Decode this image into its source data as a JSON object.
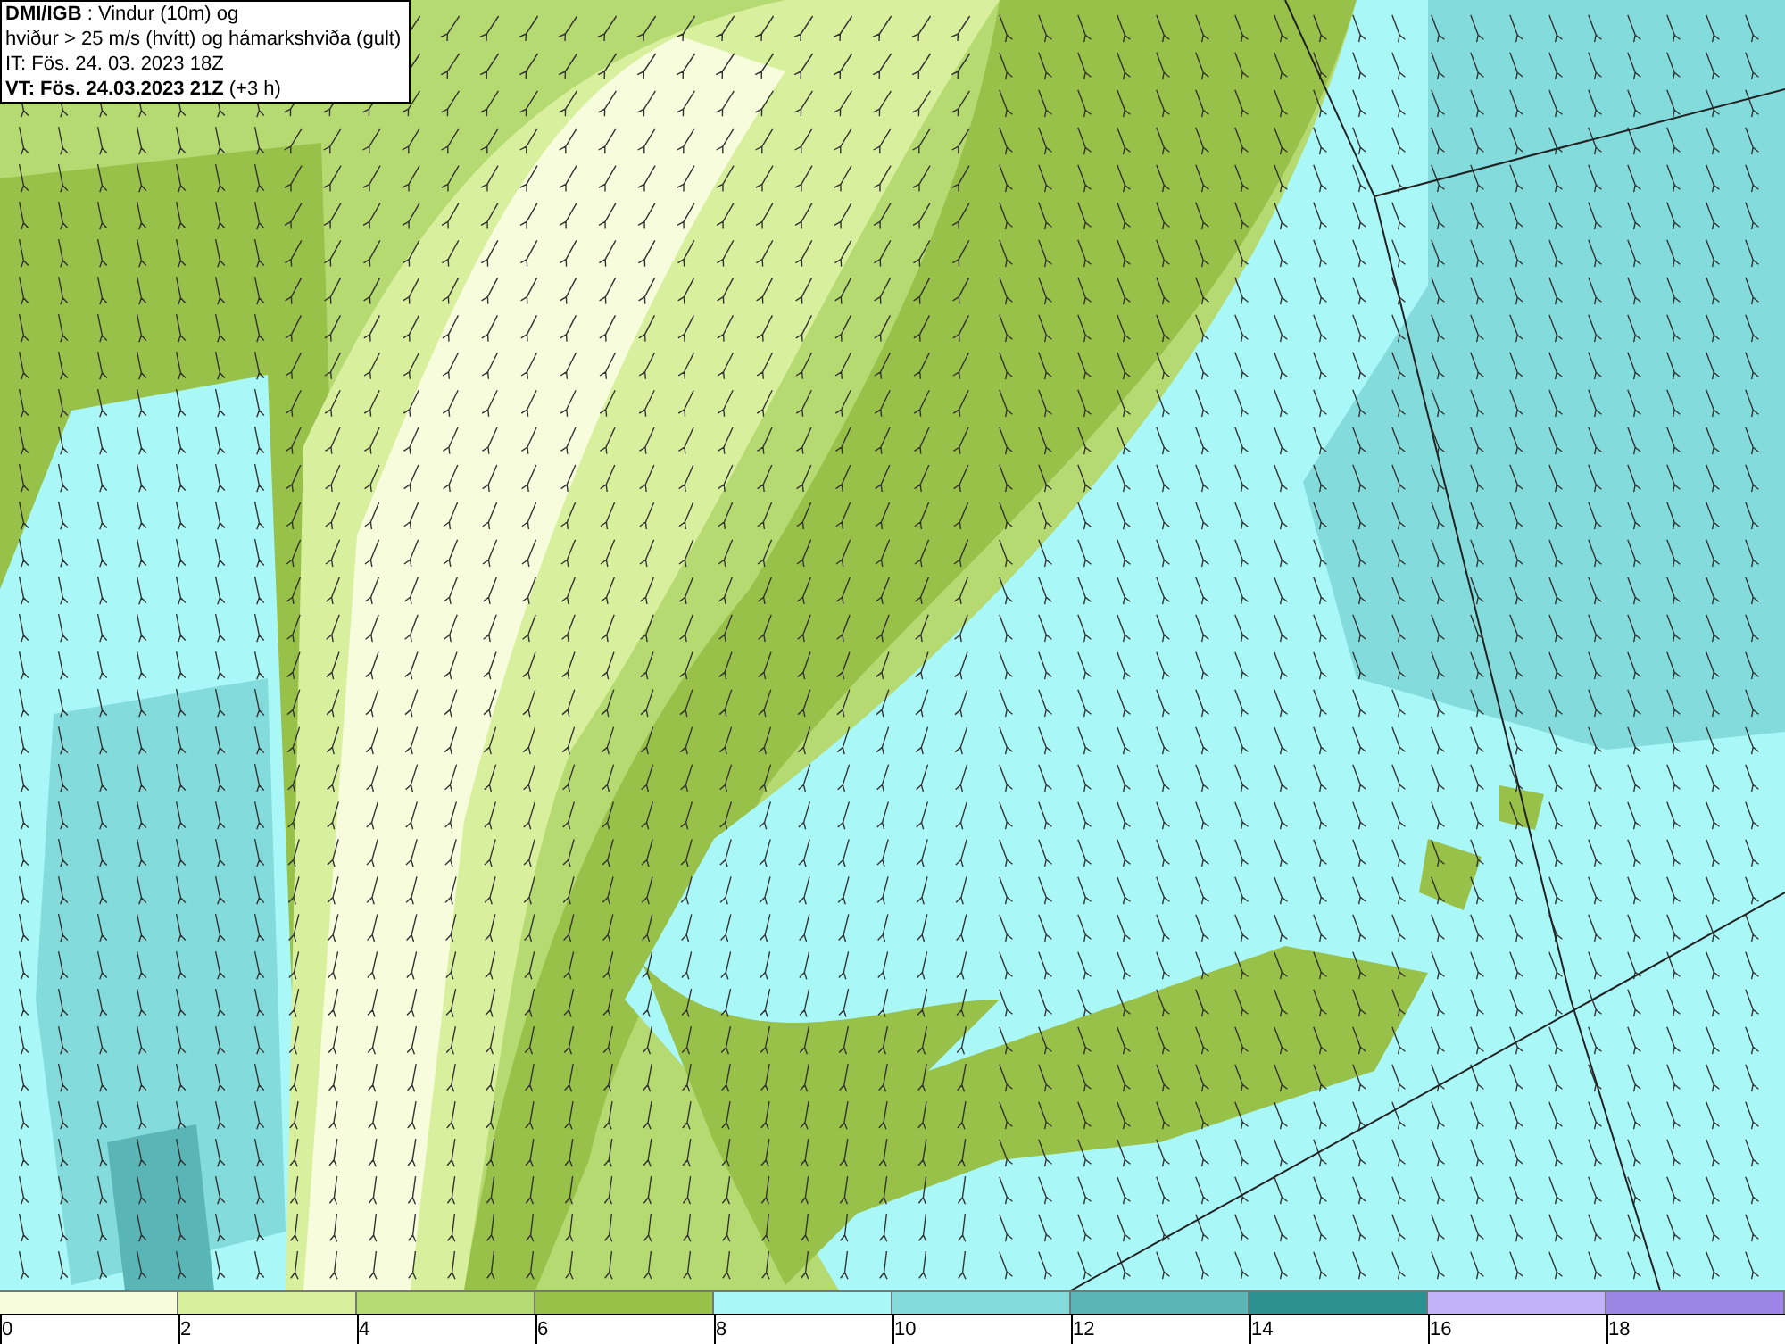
{
  "header": {
    "lines": [
      "**DMI/IGB** : Vindur (10m) og",
      "hviður > 25 m/s (hvítt) og hámarkshviða (gult)",
      "IT: Fös. 24. 03. 2023 18Z",
      "**VT: Fös. 24.03.2023 21Z** (+3 h)"
    ]
  },
  "legend": [
    {
      "label": "0",
      "color": "#f6fcdc"
    },
    {
      "label": "2",
      "color": "#d8f09e"
    },
    {
      "label": "4",
      "color": "#b6da72"
    },
    {
      "label": "6",
      "color": "#98c14a"
    },
    {
      "label": "8",
      "color": "#aaf7f7"
    },
    {
      "label": "10",
      "color": "#84dbdb"
    },
    {
      "label": "12",
      "color": "#5ab6b6"
    },
    {
      "label": "14",
      "color": "#2a9090"
    },
    {
      "label": "16",
      "color": "#c2b2f8"
    },
    {
      "label": "18",
      "color": "#9c84e4"
    }
  ]
}
